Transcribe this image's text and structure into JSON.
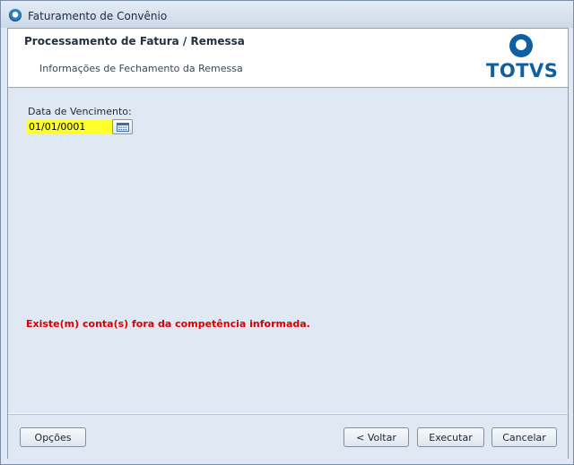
{
  "window": {
    "title": "Faturamento de Convênio"
  },
  "header": {
    "title": "Processamento de Fatura / Remessa",
    "subtitle": "Informações de Fechamento da Remessa",
    "logo_text": "TOTVS"
  },
  "form": {
    "due_date_label": "Data de Vencimento:",
    "due_date_value": "01/01/0001"
  },
  "warning": "Existe(m) conta(s) fora da competência informada.",
  "buttons": {
    "options": "Opções",
    "back": "< Voltar",
    "execute": "Executar",
    "cancel": "Cancelar"
  },
  "colors": {
    "warning": "#d80000",
    "field_highlight": "#ffff2a",
    "brand": "#0f5fa3"
  },
  "icons": [
    "app-icon",
    "calendar-icon",
    "totvs-logo"
  ]
}
